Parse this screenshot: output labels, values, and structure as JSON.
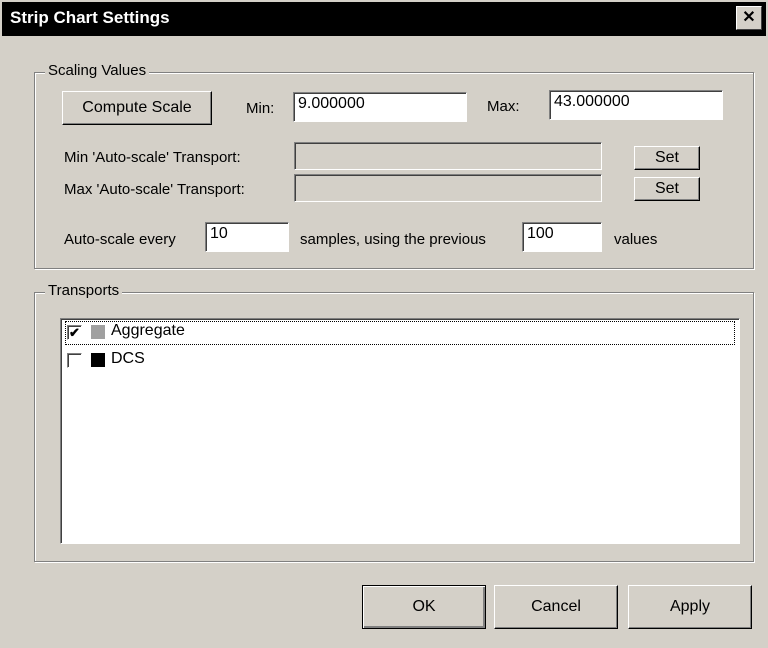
{
  "window": {
    "title": "Strip Chart Settings",
    "close_glyph": "✕"
  },
  "scaling": {
    "legend": "Scaling Values",
    "compute_label": "Compute Scale",
    "min_label": "Min:",
    "min_value": "9.000000",
    "max_label": "Max:",
    "max_value": "43.000000",
    "min_transport_label": "Min 'Auto-scale' Transport:",
    "min_transport_value": "",
    "max_transport_label": "Max 'Auto-scale' Transport:",
    "max_transport_value": "",
    "set_label": "Set",
    "autoscale_prefix": "Auto-scale every",
    "autoscale_every_value": "10",
    "autoscale_middle": "samples, using the previous",
    "autoscale_previous_value": "100",
    "autoscale_suffix": "values"
  },
  "transports": {
    "legend": "Transports",
    "items": [
      {
        "label": "Aggregate",
        "checked": true,
        "check_glyph": "✔",
        "color": "#a0a0a0"
      },
      {
        "label": "DCS",
        "checked": false,
        "check_glyph": "",
        "color": "#000000"
      }
    ]
  },
  "buttons": {
    "ok": "OK",
    "cancel": "Cancel",
    "apply": "Apply"
  }
}
